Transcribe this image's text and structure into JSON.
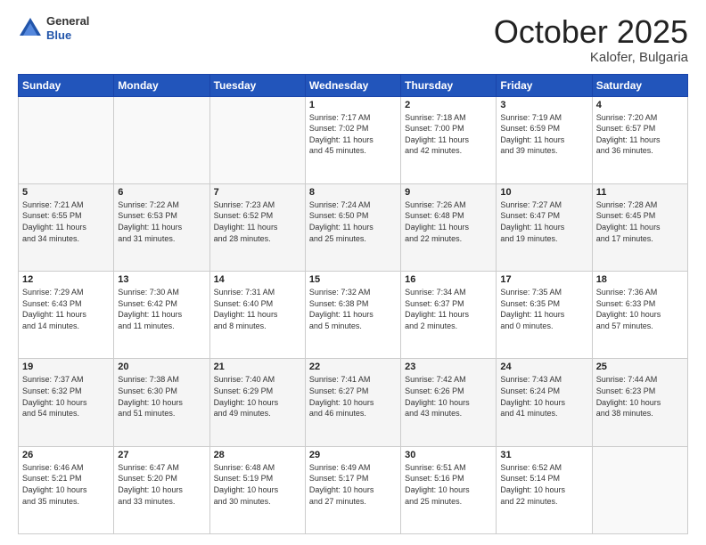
{
  "header": {
    "logo_general": "General",
    "logo_blue": "Blue",
    "month": "October 2025",
    "location": "Kalofer, Bulgaria"
  },
  "days_of_week": [
    "Sunday",
    "Monday",
    "Tuesday",
    "Wednesday",
    "Thursday",
    "Friday",
    "Saturday"
  ],
  "weeks": [
    [
      {
        "day": "",
        "info": ""
      },
      {
        "day": "",
        "info": ""
      },
      {
        "day": "",
        "info": ""
      },
      {
        "day": "1",
        "info": "Sunrise: 7:17 AM\nSunset: 7:02 PM\nDaylight: 11 hours\nand 45 minutes."
      },
      {
        "day": "2",
        "info": "Sunrise: 7:18 AM\nSunset: 7:00 PM\nDaylight: 11 hours\nand 42 minutes."
      },
      {
        "day": "3",
        "info": "Sunrise: 7:19 AM\nSunset: 6:59 PM\nDaylight: 11 hours\nand 39 minutes."
      },
      {
        "day": "4",
        "info": "Sunrise: 7:20 AM\nSunset: 6:57 PM\nDaylight: 11 hours\nand 36 minutes."
      }
    ],
    [
      {
        "day": "5",
        "info": "Sunrise: 7:21 AM\nSunset: 6:55 PM\nDaylight: 11 hours\nand 34 minutes."
      },
      {
        "day": "6",
        "info": "Sunrise: 7:22 AM\nSunset: 6:53 PM\nDaylight: 11 hours\nand 31 minutes."
      },
      {
        "day": "7",
        "info": "Sunrise: 7:23 AM\nSunset: 6:52 PM\nDaylight: 11 hours\nand 28 minutes."
      },
      {
        "day": "8",
        "info": "Sunrise: 7:24 AM\nSunset: 6:50 PM\nDaylight: 11 hours\nand 25 minutes."
      },
      {
        "day": "9",
        "info": "Sunrise: 7:26 AM\nSunset: 6:48 PM\nDaylight: 11 hours\nand 22 minutes."
      },
      {
        "day": "10",
        "info": "Sunrise: 7:27 AM\nSunset: 6:47 PM\nDaylight: 11 hours\nand 19 minutes."
      },
      {
        "day": "11",
        "info": "Sunrise: 7:28 AM\nSunset: 6:45 PM\nDaylight: 11 hours\nand 17 minutes."
      }
    ],
    [
      {
        "day": "12",
        "info": "Sunrise: 7:29 AM\nSunset: 6:43 PM\nDaylight: 11 hours\nand 14 minutes."
      },
      {
        "day": "13",
        "info": "Sunrise: 7:30 AM\nSunset: 6:42 PM\nDaylight: 11 hours\nand 11 minutes."
      },
      {
        "day": "14",
        "info": "Sunrise: 7:31 AM\nSunset: 6:40 PM\nDaylight: 11 hours\nand 8 minutes."
      },
      {
        "day": "15",
        "info": "Sunrise: 7:32 AM\nSunset: 6:38 PM\nDaylight: 11 hours\nand 5 minutes."
      },
      {
        "day": "16",
        "info": "Sunrise: 7:34 AM\nSunset: 6:37 PM\nDaylight: 11 hours\nand 2 minutes."
      },
      {
        "day": "17",
        "info": "Sunrise: 7:35 AM\nSunset: 6:35 PM\nDaylight: 11 hours\nand 0 minutes."
      },
      {
        "day": "18",
        "info": "Sunrise: 7:36 AM\nSunset: 6:33 PM\nDaylight: 10 hours\nand 57 minutes."
      }
    ],
    [
      {
        "day": "19",
        "info": "Sunrise: 7:37 AM\nSunset: 6:32 PM\nDaylight: 10 hours\nand 54 minutes."
      },
      {
        "day": "20",
        "info": "Sunrise: 7:38 AM\nSunset: 6:30 PM\nDaylight: 10 hours\nand 51 minutes."
      },
      {
        "day": "21",
        "info": "Sunrise: 7:40 AM\nSunset: 6:29 PM\nDaylight: 10 hours\nand 49 minutes."
      },
      {
        "day": "22",
        "info": "Sunrise: 7:41 AM\nSunset: 6:27 PM\nDaylight: 10 hours\nand 46 minutes."
      },
      {
        "day": "23",
        "info": "Sunrise: 7:42 AM\nSunset: 6:26 PM\nDaylight: 10 hours\nand 43 minutes."
      },
      {
        "day": "24",
        "info": "Sunrise: 7:43 AM\nSunset: 6:24 PM\nDaylight: 10 hours\nand 41 minutes."
      },
      {
        "day": "25",
        "info": "Sunrise: 7:44 AM\nSunset: 6:23 PM\nDaylight: 10 hours\nand 38 minutes."
      }
    ],
    [
      {
        "day": "26",
        "info": "Sunrise: 6:46 AM\nSunset: 5:21 PM\nDaylight: 10 hours\nand 35 minutes."
      },
      {
        "day": "27",
        "info": "Sunrise: 6:47 AM\nSunset: 5:20 PM\nDaylight: 10 hours\nand 33 minutes."
      },
      {
        "day": "28",
        "info": "Sunrise: 6:48 AM\nSunset: 5:19 PM\nDaylight: 10 hours\nand 30 minutes."
      },
      {
        "day": "29",
        "info": "Sunrise: 6:49 AM\nSunset: 5:17 PM\nDaylight: 10 hours\nand 27 minutes."
      },
      {
        "day": "30",
        "info": "Sunrise: 6:51 AM\nSunset: 5:16 PM\nDaylight: 10 hours\nand 25 minutes."
      },
      {
        "day": "31",
        "info": "Sunrise: 6:52 AM\nSunset: 5:14 PM\nDaylight: 10 hours\nand 22 minutes."
      },
      {
        "day": "",
        "info": ""
      }
    ]
  ]
}
